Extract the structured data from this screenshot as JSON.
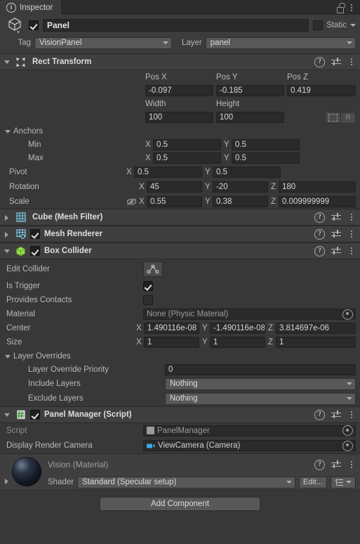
{
  "window": {
    "tab_label": "Inspector",
    "tab_icon": "info-icon",
    "lock_icon": "unlocked-padlock-icon",
    "menu_icon": "kebab-menu-icon"
  },
  "game_object": {
    "icon": "cube-gameobject-icon",
    "enabled": true,
    "name": "Panel",
    "static_label": "Static",
    "static_checked": false,
    "tag_label": "Tag",
    "tag_value": "VisionPanel",
    "layer_label": "Layer",
    "layer_value": "panel"
  },
  "components": [
    {
      "id": "rect-transform",
      "title": "Rect Transform",
      "icon": "rect-transform-icon",
      "expanded": true,
      "has_enable_toggle": false,
      "header_icons": [
        "help-icon",
        "preset-icon",
        "kebab-menu-icon"
      ],
      "columns": [
        "Pos X",
        "Pos Y",
        "Pos Z"
      ],
      "position": {
        "x": "-0.097",
        "y": "-0.185",
        "z": "0.419"
      },
      "size_columns": [
        "Width",
        "Height"
      ],
      "size": {
        "width": "100",
        "height": "100"
      },
      "blueprint_label": "",
      "raw_label": "R",
      "anchors_label": "Anchors",
      "anchor_min_label": "Min",
      "anchor_min": {
        "x": "0.5",
        "y": "0.5"
      },
      "anchor_max_label": "Max",
      "anchor_max": {
        "x": "0.5",
        "y": "0.5"
      },
      "pivot_label": "Pivot",
      "pivot": {
        "x": "0.5",
        "y": "0.5"
      },
      "rotation_label": "Rotation",
      "rotation": {
        "x": "45",
        "y": "-20",
        "z": "180"
      },
      "scale_label": "Scale",
      "scale": {
        "x": "0.55",
        "y": "0.38",
        "z": "0.009999999"
      },
      "scale_link_icon": "eye-slash-icon",
      "axis_x": "X",
      "axis_y": "Y",
      "axis_z": "Z"
    },
    {
      "id": "mesh-filter",
      "title": "Cube (Mesh Filter)",
      "icon": "mesh-filter-icon",
      "expanded": false,
      "has_enable_toggle": false
    },
    {
      "id": "mesh-renderer",
      "title": "Mesh Renderer",
      "icon": "mesh-renderer-icon",
      "expanded": false,
      "has_enable_toggle": true,
      "enabled": true
    },
    {
      "id": "box-collider",
      "title": "Box Collider",
      "icon": "box-collider-icon",
      "expanded": true,
      "has_enable_toggle": true,
      "enabled": true,
      "edit_collider_label": "Edit Collider",
      "edit_collider_icon": "edit-collider-icon",
      "is_trigger_label": "Is Trigger",
      "is_trigger": true,
      "provides_contacts_label": "Provides Contacts",
      "provides_contacts": false,
      "material_label": "Material",
      "material_value": "None (Physic Material)",
      "center_label": "Center",
      "center": {
        "x": "1.490116e-08",
        "y": "-1.490116e-08",
        "z": "3.814697e-06"
      },
      "size_label": "Size",
      "size": {
        "x": "1",
        "y": "1",
        "z": "1"
      },
      "layer_overrides_label": "Layer Overrides",
      "layer_override_priority_label": "Layer Override Priority",
      "layer_override_priority": "0",
      "include_layers_label": "Include Layers",
      "include_layers": "Nothing",
      "exclude_layers_label": "Exclude Layers",
      "exclude_layers": "Nothing"
    },
    {
      "id": "panel-manager",
      "title": "Panel Manager (Script)",
      "icon": "cs-script-icon",
      "expanded": true,
      "has_enable_toggle": true,
      "enabled": true,
      "script_label": "Script",
      "script_value": "PanelManager",
      "script_value_icon": "script-asset-icon",
      "display_render_camera_label": "Display Render Camera",
      "display_render_camera_value": "ViewCamera (Camera)",
      "display_render_camera_icon": "camera-icon"
    }
  ],
  "material": {
    "title": "Vision  (Material)",
    "preview_icon": "material-sphere-preview",
    "shader_label": "Shader",
    "shader_value": "Standard (Specular setup)",
    "edit_button": "Edit...",
    "preset_icon": "shader-preset-icon",
    "header_icons": [
      "help-icon",
      "preset-icon",
      "kebab-menu-icon"
    ]
  },
  "footer": {
    "add_component_label": "Add Component"
  },
  "colors": {
    "panel_bg": "#383838",
    "header_bg": "#3f3f3f",
    "field_bg": "#2a2a2a",
    "dropdown_bg": "#585858",
    "text": "#b9b9b9",
    "mesh_icon": "#7fd0f0",
    "collider_icon": "#9ade53",
    "script_icon": "#3fb63f"
  }
}
